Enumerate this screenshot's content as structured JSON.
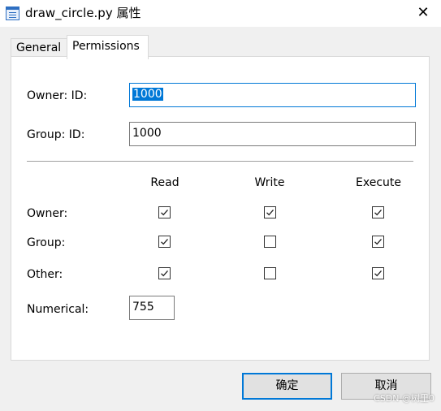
{
  "window": {
    "title": "draw_circle.py 属性",
    "close_glyph": "✕"
  },
  "tabs": [
    {
      "label": "General",
      "active": false
    },
    {
      "label": "Permissions",
      "active": true
    }
  ],
  "owner": {
    "label": "Owner: ID:",
    "value": "1000"
  },
  "group": {
    "label": "Group: ID:",
    "value": "1000"
  },
  "columns": {
    "read": "Read",
    "write": "Write",
    "execute": "Execute"
  },
  "rows": [
    {
      "label": "Owner:",
      "read": true,
      "write": true,
      "execute": true
    },
    {
      "label": "Group:",
      "read": true,
      "write": false,
      "execute": true
    },
    {
      "label": "Other:",
      "read": true,
      "write": false,
      "execute": true
    }
  ],
  "numerical": {
    "label": "Numerical:",
    "value": "755"
  },
  "buttons": {
    "ok": "确定",
    "cancel": "取消"
  },
  "watermark": "CSDN @树里0",
  "colors": {
    "accent": "#0078d7",
    "dialog_bg": "#f0f0f0",
    "panel_bg": "#ffffff"
  }
}
